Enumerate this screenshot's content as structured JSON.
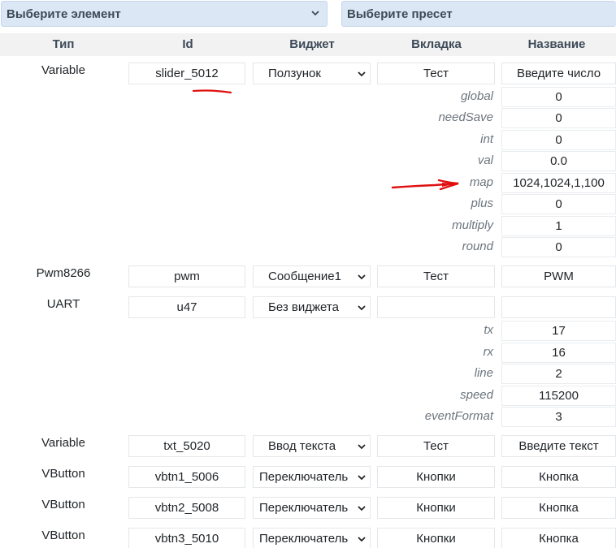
{
  "top": {
    "element_select": "Выберите элемент",
    "preset_select": "Выберите пресет"
  },
  "headers": [
    "Тип",
    "Id",
    "Виджет",
    "Вкладка",
    "Название"
  ],
  "rows": [
    {
      "type": "Variable",
      "id": "slider_5012",
      "widget": "Ползунок",
      "tab": "Тест",
      "name": "Введите число",
      "params": [
        {
          "label": "global",
          "value": "0"
        },
        {
          "label": "needSave",
          "value": "0"
        },
        {
          "label": "int",
          "value": "0"
        },
        {
          "label": "val",
          "value": "0.0"
        },
        {
          "label": "map",
          "value": "1024,1024,1,100"
        },
        {
          "label": "plus",
          "value": "0"
        },
        {
          "label": "multiply",
          "value": "1"
        },
        {
          "label": "round",
          "value": "0"
        }
      ]
    },
    {
      "type": "Pwm8266",
      "id": "pwm",
      "widget": "Сообщение1",
      "tab": "Тест",
      "name": "PWM"
    },
    {
      "type": "UART",
      "id": "u47",
      "widget": "Без виджета",
      "tab": "",
      "name": "",
      "params": [
        {
          "label": "tx",
          "value": "17"
        },
        {
          "label": "rx",
          "value": "16"
        },
        {
          "label": "line",
          "value": "2"
        },
        {
          "label": "speed",
          "value": "115200"
        },
        {
          "label": "eventFormat",
          "value": "3"
        }
      ]
    },
    {
      "type": "Variable",
      "id": "txt_5020",
      "widget": "Ввод текста",
      "tab": "Тест",
      "name": "Введите текст"
    },
    {
      "type": "VButton",
      "id": "vbtn1_5006",
      "widget": "Переключатель",
      "tab": "Кнопки",
      "name": "Кнопка"
    },
    {
      "type": "VButton",
      "id": "vbtn2_5008",
      "widget": "Переключатель",
      "tab": "Кнопки",
      "name": "Кнопка"
    },
    {
      "type": "VButton",
      "id": "vbtn3_5010",
      "widget": "Переключатель",
      "tab": "Кнопки",
      "name": "Кнопка"
    }
  ],
  "annotation_color": "#e01010"
}
